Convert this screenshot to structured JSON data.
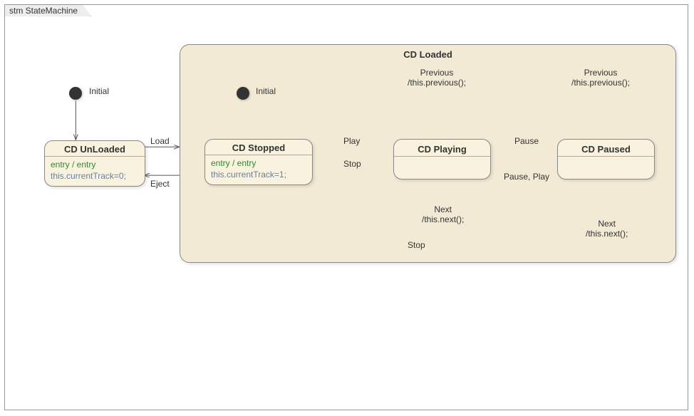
{
  "frame": {
    "title": "stm StateMachine"
  },
  "outer_initial_label": "Initial",
  "inner_initial_label": "Initial",
  "states": {
    "unloaded": {
      "title": "CD UnLoaded",
      "entry_label": "entry / entry",
      "entry_code": "this.currentTrack=0;"
    },
    "loaded": {
      "title": "CD Loaded"
    },
    "stopped": {
      "title": "CD Stopped",
      "entry_label": "entry / entry",
      "entry_code": "this.currentTrack=1;"
    },
    "playing": {
      "title": "CD Playing"
    },
    "paused": {
      "title": "CD Paused"
    }
  },
  "transitions": {
    "load": "Load",
    "eject": "Eject",
    "play": "Play",
    "stop_playing_to_stopped": "Stop",
    "pause": "Pause",
    "pause_play": "Pause, Play",
    "stop_paused_to_stopped": "Stop",
    "prev_playing": {
      "trigger": "Previous",
      "action": "/this.previous();"
    },
    "next_playing": {
      "trigger": "Next",
      "action": "/this.next();"
    },
    "prev_paused": {
      "trigger": "Previous",
      "action": "/this.previous();"
    },
    "next_paused": {
      "trigger": "Next",
      "action": "/this.next();"
    }
  }
}
